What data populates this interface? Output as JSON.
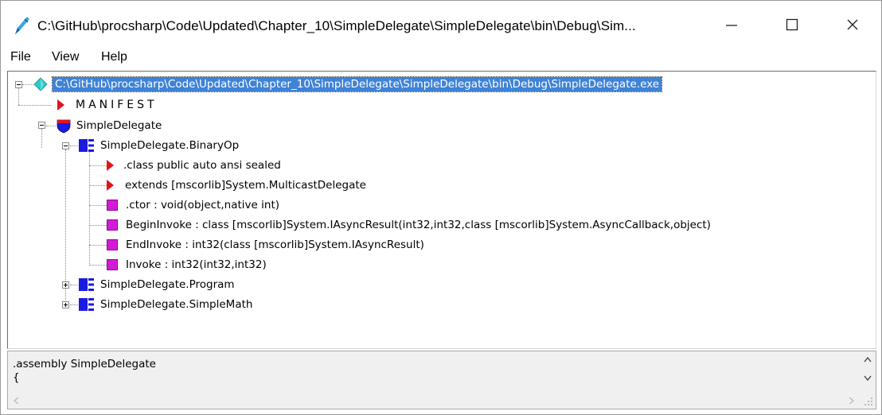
{
  "window": {
    "title": "C:\\GitHub\\procsharp\\Code\\Updated\\Chapter_10\\SimpleDelegate\\SimpleDelegate\\bin\\Debug\\Sim...",
    "minimize": "—",
    "maximize": "☐",
    "close": "✕"
  },
  "menu": {
    "file": "File",
    "view": "View",
    "help": "Help"
  },
  "tree": {
    "root": "C:\\GitHub\\procsharp\\Code\\Updated\\Chapter_10\\SimpleDelegate\\SimpleDelegate\\bin\\Debug\\SimpleDelegate.exe",
    "manifest": "MANIFEST",
    "namespace": "SimpleDelegate",
    "binaryop": "SimpleDelegate.BinaryOp",
    "binaryop_children": [
      ".class public auto ansi sealed",
      "extends [mscorlib]System.MulticastDelegate",
      ".ctor : void(object,native int)",
      "BeginInvoke : class [mscorlib]System.IAsyncResult(int32,int32,class [mscorlib]System.AsyncCallback,object)",
      "EndInvoke : int32(class [mscorlib]System.IAsyncResult)",
      "Invoke : int32(int32,int32)"
    ],
    "program": "SimpleDelegate.Program",
    "simplemath": "SimpleDelegate.SimpleMath"
  },
  "bottom": {
    "line1": ".assembly SimpleDelegate",
    "line2": "{"
  },
  "icons": {
    "app": "pen-icon",
    "root": "diamond-icon",
    "manifest": "red-triangle-icon",
    "namespace": "shield-icon",
    "class": "class-icon",
    "method": "method-icon"
  },
  "colors": {
    "selection": "#3f83d6",
    "red_marker": "#e0141c",
    "method": "#d31ad6",
    "class": "#1a1ae0",
    "diamond": "#2fc7c7"
  }
}
